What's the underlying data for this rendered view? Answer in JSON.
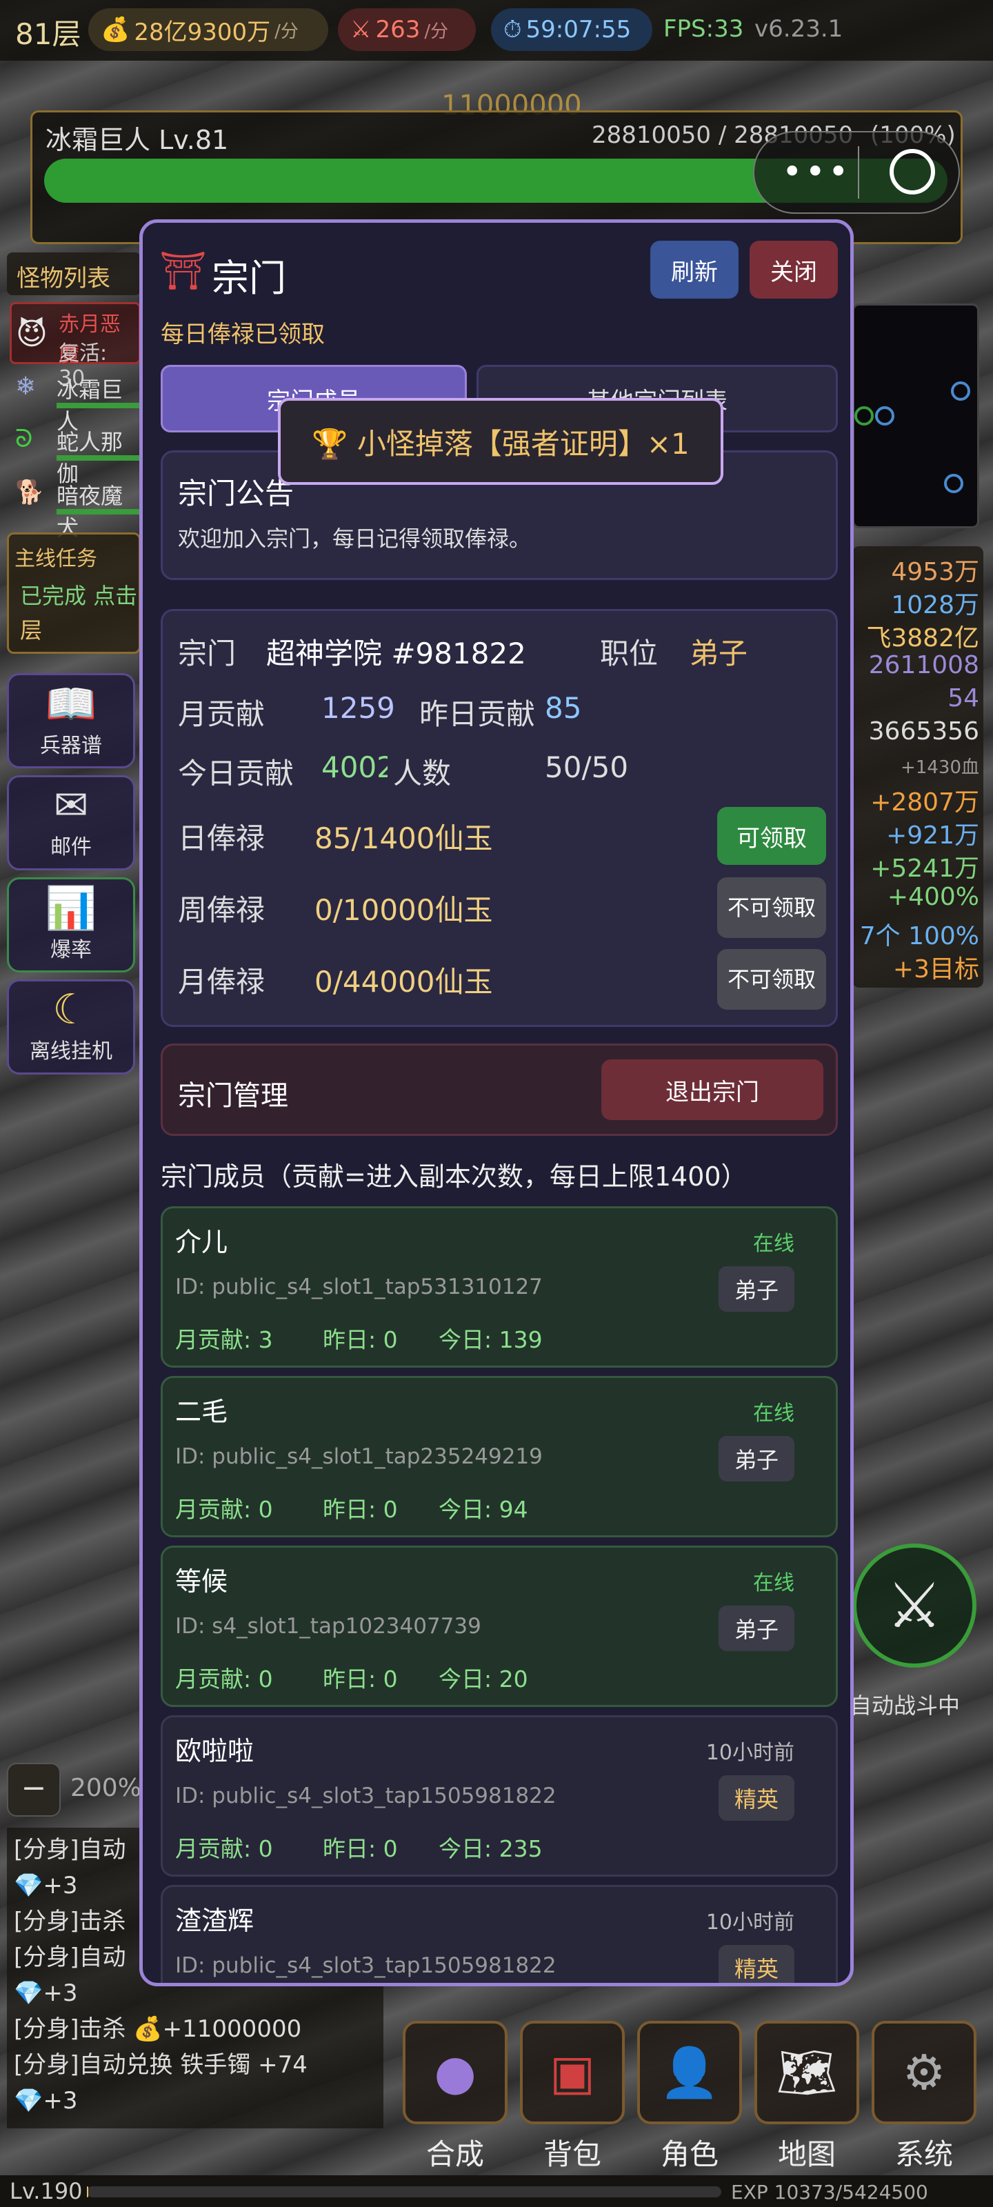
{
  "topbar": {
    "floor": "81层",
    "gold": "28亿9300万",
    "gold_unit": "/分",
    "attack": "263",
    "attack_unit": "/分",
    "timer": "59:07:55",
    "fps": "FPS:33",
    "version": "v6.23.1"
  },
  "boss": {
    "name": "冰霜巨人 Lv.81",
    "hp_text": "28810050 / 28810050",
    "hp_percent": "(100%)",
    "hp_fraction": 1.0,
    "behind_text": "11000000"
  },
  "monster_list": {
    "title": "怪物列表",
    "items": [
      {
        "name": "赤月恶魔",
        "sub": "复活: 30"
      },
      {
        "name": "冰霜巨人"
      },
      {
        "name": "蛇人那伽"
      },
      {
        "name": "暗夜魔犬"
      }
    ]
  },
  "quest": {
    "title": "主线任务",
    "line1": "已完成 点击",
    "line2": "层"
  },
  "side_buttons": [
    {
      "label": "兵器谱"
    },
    {
      "label": "邮件"
    },
    {
      "label": "爆率"
    },
    {
      "label": "离线挂机"
    }
  ],
  "right_stats": [
    "4953万",
    "1028万",
    "飞3882亿",
    "2611008",
    "54",
    "3665356",
    "+1430血",
    "+2807万",
    "+921万",
    "+5241万",
    "+400%",
    "7个 100%",
    "+3目标"
  ],
  "auto_battle": {
    "label": "自动战斗中"
  },
  "speed": {
    "minus": "−",
    "value": "200%"
  },
  "log_lines": [
    "[分身]自动",
    "💎+3",
    "[分身]击杀",
    "[分身]自动",
    "💎+3",
    "[分身]击杀 💰+11000000",
    "[分身]自动兑换 铁手镯 +74",
    "💎+3"
  ],
  "bottom_nav": [
    {
      "label": "合成"
    },
    {
      "label": "背包"
    },
    {
      "label": "角色"
    },
    {
      "label": "地图"
    },
    {
      "label": "系统"
    }
  ],
  "bottom_status": {
    "level": "Lv.190",
    "exp": "EXP 10373/5424500 (0.2%)",
    "exp_fraction": 0.002
  },
  "modal": {
    "title": "宗门",
    "refresh": "刷新",
    "close": "关闭",
    "daily_status": "每日俸禄已领取",
    "tabs": [
      "宗门成员",
      "其他宗门列表"
    ],
    "toast": "🏆 小怪掉落【强者证明】×1",
    "notice_title": "宗门公告",
    "notice_text": "欢迎加入宗门，每日记得领取俸禄。",
    "info": {
      "sect_label": "宗门",
      "sect_name": "超神学院 #981822",
      "pos_label": "职位",
      "pos_value": "弟子",
      "month_label": "月贡献",
      "month_value": "1259",
      "yday_label": "昨日贡献",
      "yday_value": "85",
      "today_label": "今日贡献",
      "today_value": "4002",
      "count_label": "人数",
      "count_value": "50/50"
    },
    "salary": [
      {
        "label": "日俸禄",
        "value": "85/1400仙玉",
        "button": "可领取",
        "active": true
      },
      {
        "label": "周俸禄",
        "value": "0/10000仙玉",
        "button": "不可领取",
        "active": false
      },
      {
        "label": "月俸禄",
        "value": "0/44000仙玉",
        "button": "不可领取",
        "active": false
      }
    ],
    "manage_title": "宗门管理",
    "quit": "退出宗门",
    "members_title": "宗门成员（贡献=进入副本次数，每日上限1400）",
    "members": [
      {
        "name": "介儿",
        "status": "在线",
        "online": true,
        "id": "ID: public_s4_slot1_tap531310127",
        "role": "弟子",
        "month": "月贡献: 3",
        "yday": "昨日: 0",
        "today": "今日: 139"
      },
      {
        "name": "二毛",
        "status": "在线",
        "online": true,
        "id": "ID: public_s4_slot1_tap235249219",
        "role": "弟子",
        "month": "月贡献: 0",
        "yday": "昨日: 0",
        "today": "今日: 94"
      },
      {
        "name": "等候",
        "status": "在线",
        "online": true,
        "id": "ID: s4_slot1_tap1023407739",
        "role": "弟子",
        "month": "月贡献: 0",
        "yday": "昨日: 0",
        "today": "今日: 20"
      },
      {
        "name": "欧啦啦",
        "status": "10小时前",
        "online": false,
        "id": "ID: public_s4_slot3_tap1505981822",
        "role": "精英",
        "month": "月贡献: 0",
        "yday": "昨日: 0",
        "today": "今日: 235"
      },
      {
        "name": "渣渣辉",
        "status": "10小时前",
        "online": false,
        "id": "ID: public_s4_slot3_tap1505981822",
        "role": "精英",
        "month": "",
        "yday": "",
        "today": ""
      }
    ]
  }
}
